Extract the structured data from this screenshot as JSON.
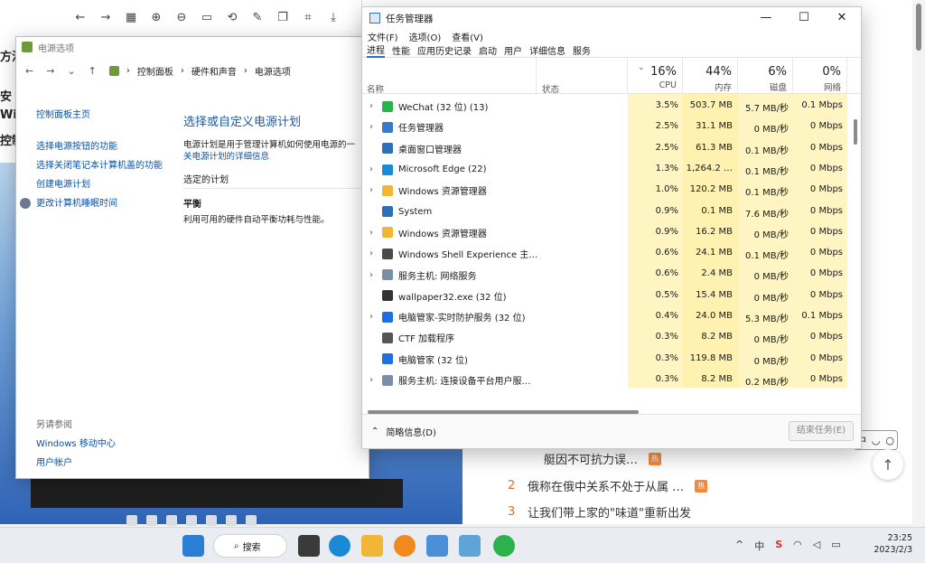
{
  "background": {
    "left_fragments": [
      "方法",
      "安",
      "Wir",
      "控制"
    ],
    "news": [
      {
        "num": "",
        "text": "艇因不可抗力误…",
        "badge": "热"
      },
      {
        "num": "2",
        "text": "俄称在俄中关系不处于从属 …",
        "badge": "热"
      },
      {
        "num": "3",
        "text": "让我们带上家的\"味道\"重新出发",
        "badge": ""
      }
    ],
    "ime": {
      "lang": "中",
      "mode": "◡",
      "dot": "○"
    },
    "up_arrow": "↑"
  },
  "power_window": {
    "title": "电源选项",
    "breadcrumb": [
      "控制面板",
      "硬件和声音",
      "电源选项"
    ],
    "sidebar": [
      "控制面板主页",
      "选择电源按钮的功能",
      "选择关闭笔记本计算机盖的功能",
      "创建电源计划",
      "更改计算机睡眠时间"
    ],
    "heading": "选择或自定义电源计划",
    "desc_line1": "电源计划是用于管理计算机如何使用电源的一",
    "desc_link": "关电源计划的详细信息",
    "selected_label": "选定的计划",
    "plan_name": "平衡",
    "plan_desc": "利用可用的硬件自动平衡功耗与性能。",
    "see_also_head": "另请参阅",
    "see_also": [
      "Windows 移动中心",
      "用户帐户"
    ]
  },
  "taskmgr": {
    "title": "任务管理器",
    "menu": [
      "文件(F)",
      "选项(O)",
      "查看(V)"
    ],
    "tabs": [
      "进程",
      "性能",
      "应用历史记录",
      "启动",
      "用户",
      "详细信息",
      "服务"
    ],
    "columns": {
      "name": "名称",
      "status": "状态",
      "cpu": {
        "pct": "16%",
        "label": "CPU"
      },
      "mem": {
        "pct": "44%",
        "label": "内存"
      },
      "disk": {
        "pct": "6%",
        "label": "磁盘"
      },
      "net": {
        "pct": "0%",
        "label": "网络"
      }
    },
    "rows": [
      {
        "expand": true,
        "name": "WeChat (32 位) (13)",
        "cpu": "3.5%",
        "mem": "503.7 MB",
        "disk": "5.7 MB/秒",
        "net": "0.1 Mbps",
        "icon": "wechat-icon",
        "color": "#2bb24c"
      },
      {
        "expand": true,
        "name": "任务管理器",
        "cpu": "2.5%",
        "mem": "31.1 MB",
        "disk": "0 MB/秒",
        "net": "0 Mbps",
        "icon": "taskmgr-icon",
        "color": "#3a79c8"
      },
      {
        "expand": false,
        "name": "桌面窗口管理器",
        "cpu": "2.5%",
        "mem": "61.3 MB",
        "disk": "0.1 MB/秒",
        "net": "0 Mbps",
        "icon": "dwm-icon",
        "color": "#2d6fb8"
      },
      {
        "expand": true,
        "name": "Microsoft Edge (22)",
        "cpu": "1.3%",
        "mem": "1,264.2 …",
        "disk": "0.1 MB/秒",
        "net": "0 Mbps",
        "icon": "edge-icon",
        "color": "#1a8ad6"
      },
      {
        "expand": true,
        "name": "Windows 资源管理器",
        "cpu": "1.0%",
        "mem": "120.2 MB",
        "disk": "0.1 MB/秒",
        "net": "0 Mbps",
        "icon": "folder-icon",
        "color": "#f2b636"
      },
      {
        "expand": false,
        "name": "System",
        "cpu": "0.9%",
        "mem": "0.1 MB",
        "disk": "7.6 MB/秒",
        "net": "0 Mbps",
        "icon": "system-icon",
        "color": "#2d6fb8"
      },
      {
        "expand": true,
        "name": "Windows 资源管理器",
        "cpu": "0.9%",
        "mem": "16.2 MB",
        "disk": "0 MB/秒",
        "net": "0 Mbps",
        "icon": "folder-icon",
        "color": "#f2b636"
      },
      {
        "expand": true,
        "name": "Windows Shell Experience 主…",
        "cpu": "0.6%",
        "mem": "24.1 MB",
        "disk": "0.1 MB/秒",
        "net": "0 Mbps",
        "icon": "shell-icon",
        "color": "#4a4a4a"
      },
      {
        "expand": true,
        "name": "服务主机: 网络服务",
        "cpu": "0.6%",
        "mem": "2.4 MB",
        "disk": "0 MB/秒",
        "net": "0 Mbps",
        "icon": "gear-icon",
        "color": "#7a8ea6"
      },
      {
        "expand": false,
        "name": "wallpaper32.exe (32 位)",
        "cpu": "0.5%",
        "mem": "15.4 MB",
        "disk": "0 MB/秒",
        "net": "0 Mbps",
        "icon": "wallpaper-icon",
        "color": "#333333"
      },
      {
        "expand": true,
        "name": "电脑管家-实时防护服务 (32 位)",
        "cpu": "0.4%",
        "mem": "24.0 MB",
        "disk": "5.3 MB/秒",
        "net": "0.1 Mbps",
        "icon": "shield-icon",
        "color": "#1f6fe0"
      },
      {
        "expand": false,
        "name": "CTF 加载程序",
        "cpu": "0.3%",
        "mem": "8.2 MB",
        "disk": "0 MB/秒",
        "net": "0 Mbps",
        "icon": "ctf-icon",
        "color": "#555555"
      },
      {
        "expand": false,
        "name": "电脑管家 (32 位)",
        "cpu": "0.3%",
        "mem": "119.8 MB",
        "disk": "0 MB/秒",
        "net": "0 Mbps",
        "icon": "shield-icon",
        "color": "#1f6fe0"
      },
      {
        "expand": true,
        "name": "服务主机: 连接设备平台用户服…",
        "cpu": "0.3%",
        "mem": "8.2 MB",
        "disk": "0.2 MB/秒",
        "net": "0 Mbps",
        "icon": "gear-icon",
        "color": "#7a8ea6"
      }
    ],
    "footer_label": "简略信息(D)",
    "end_task": "结束任务(E)"
  },
  "taskbar": {
    "search": "搜索",
    "time": "23:25",
    "date": "2023/2/3",
    "tray": [
      "^",
      "中",
      "S",
      "wifi",
      "vol",
      "bat"
    ]
  }
}
